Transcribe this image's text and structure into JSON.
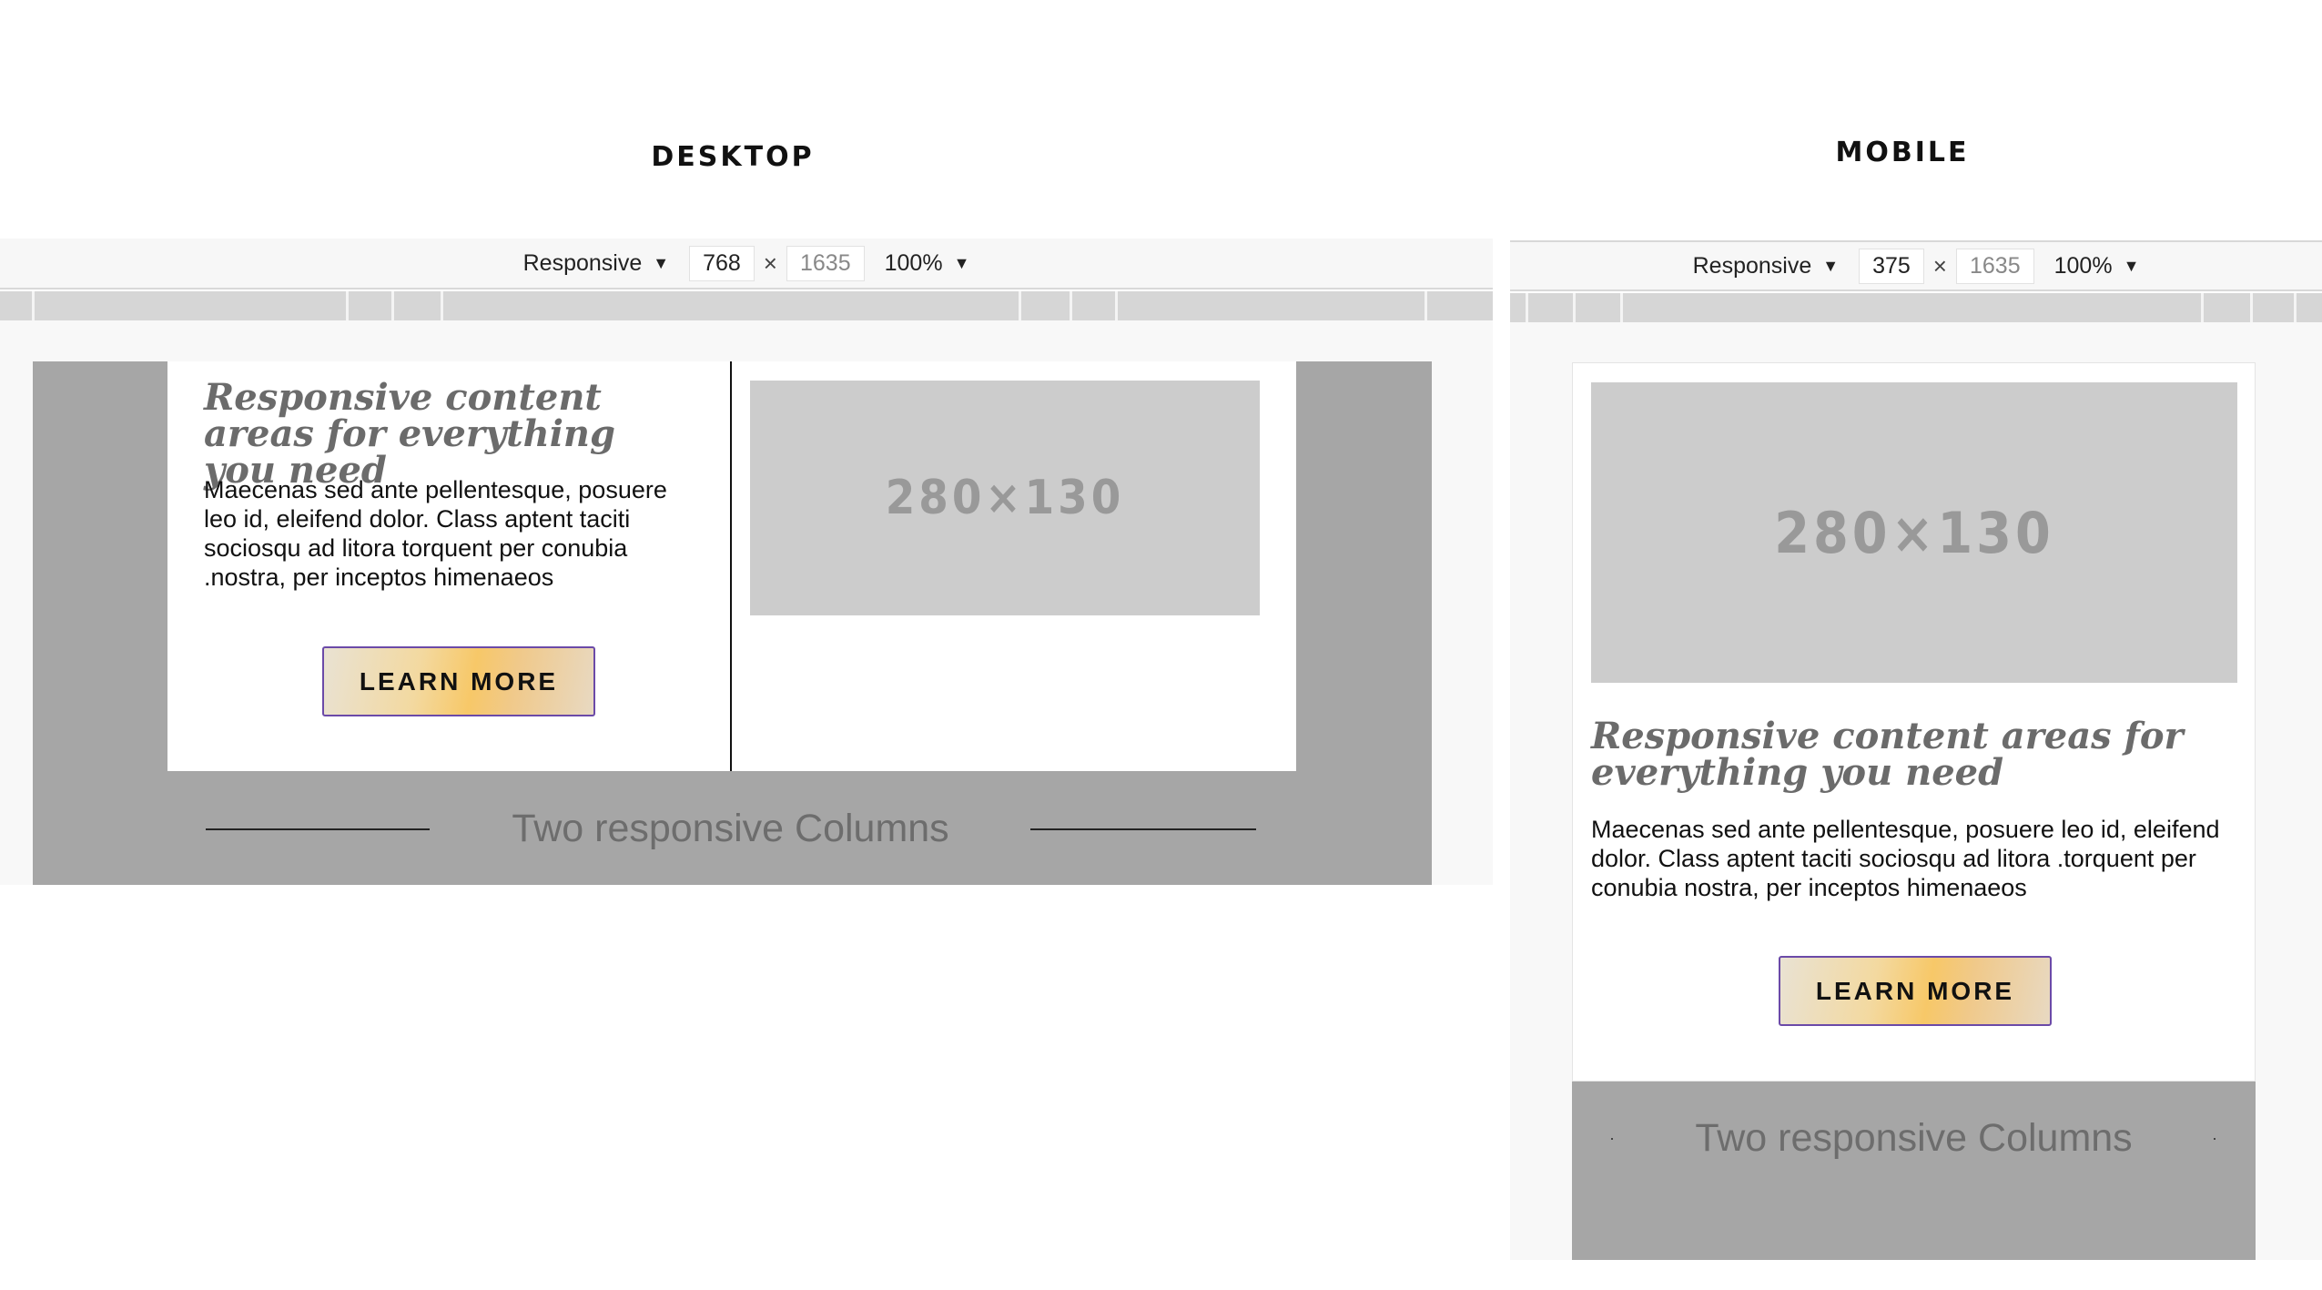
{
  "desktop": {
    "heading": "DESKTOP",
    "toolbar": {
      "device": "Responsive",
      "width": "768",
      "times": "×",
      "height": "1635",
      "zoom": "100%"
    },
    "content": {
      "title": "Responsive content areas for everything you need",
      "body": "Maecenas sed ante pellentesque, posuere leo id, eleifend dolor. Class aptent taciti sociosqu ad litora torquent per conubia .nostra, per inceptos himenaeos",
      "image_placeholder": "280×130",
      "button": "LEARN MORE",
      "footer": "Two responsive Columns"
    }
  },
  "mobile": {
    "heading": "MOBILE",
    "toolbar": {
      "device": "Responsive",
      "width": "375",
      "times": "×",
      "height": "1635",
      "zoom": "100%"
    },
    "content": {
      "title": "Responsive content areas for everything you need",
      "body": "Maecenas sed ante pellentesque, posuere leo id, eleifend dolor. Class aptent taciti sociosqu ad litora .torquent per conubia nostra, per inceptos himenaeos",
      "image_placeholder": "280×130",
      "button": "LEARN MORE",
      "footer": "Two responsive Columns"
    }
  },
  "colors": {
    "preview_gray": "#a6a6a6",
    "placeholder_gray": "#cccccc",
    "button_border": "#6b4aa8",
    "heading_gray": "#6b6b6b"
  },
  "icons": {
    "dropdown": "triangle-down-icon",
    "multiply": "times-icon"
  }
}
